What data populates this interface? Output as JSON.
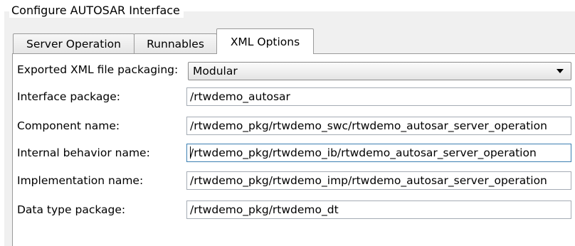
{
  "group": {
    "title": "Configure AUTOSAR Interface"
  },
  "tabs": [
    {
      "label": "Server Operation",
      "active": false
    },
    {
      "label": "Runnables",
      "active": false
    },
    {
      "label": "XML Options",
      "active": true
    }
  ],
  "form": {
    "packaging": {
      "label": "Exported XML file packaging:",
      "value": "Modular"
    },
    "interface_package": {
      "label": "Interface package:",
      "value": "/rtwdemo_autosar"
    },
    "component_name": {
      "label": "Component name:",
      "value": "/rtwdemo_pkg/rtwdemo_swc/rtwdemo_autosar_server_operation"
    },
    "internal_behavior_name": {
      "label": "Internal behavior name:",
      "value": "/rtwdemo_pkg/rtwdemo_ib/rtwdemo_autosar_server_operation"
    },
    "implementation_name": {
      "label": "Implementation name:",
      "value": "/rtwdemo_pkg/rtwdemo_imp/rtwdemo_autosar_server_operation"
    },
    "data_type_package": {
      "label": "Data type package:",
      "value": "/rtwdemo_pkg/rtwdemo_dt"
    }
  },
  "colors": {
    "panel_bg": "#ffffff",
    "frame_bg": "#f0f0f0",
    "focus_border": "#3c7fb1"
  }
}
